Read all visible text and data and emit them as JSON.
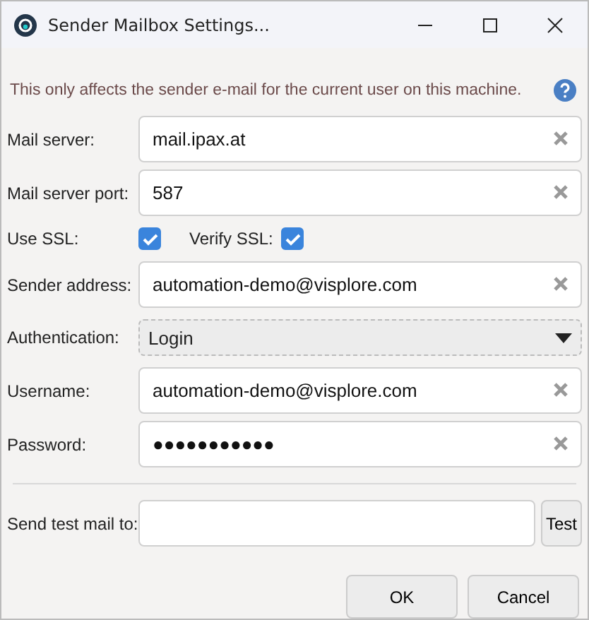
{
  "window": {
    "title": "Sender Mailbox Settings..."
  },
  "info": "This only affects the sender e-mail for the current user on this machine.",
  "fields": [
    {
      "kind": "text",
      "label": "Mail server:",
      "value": "mail.ipax.at"
    },
    {
      "kind": "text",
      "label": "Mail server port:",
      "value": "587"
    },
    {
      "kind": "checks",
      "items": [
        {
          "label": "Use SSL:",
          "checked": true
        },
        {
          "label": "Verify SSL:",
          "checked": true
        }
      ]
    },
    {
      "kind": "text",
      "label": "Sender address:",
      "value": "automation-demo@visplore.com"
    },
    {
      "kind": "select",
      "label": "Authentication:",
      "value": "Login"
    },
    {
      "kind": "text",
      "label": "Username:",
      "value": "automation-demo@visplore.com"
    },
    {
      "kind": "text",
      "label": "Password:",
      "value": "●●●●●●●●●●●"
    }
  ],
  "test": {
    "label": "Send test mail to:",
    "button": "Test"
  },
  "buttons": [
    "OK",
    "Cancel"
  ]
}
